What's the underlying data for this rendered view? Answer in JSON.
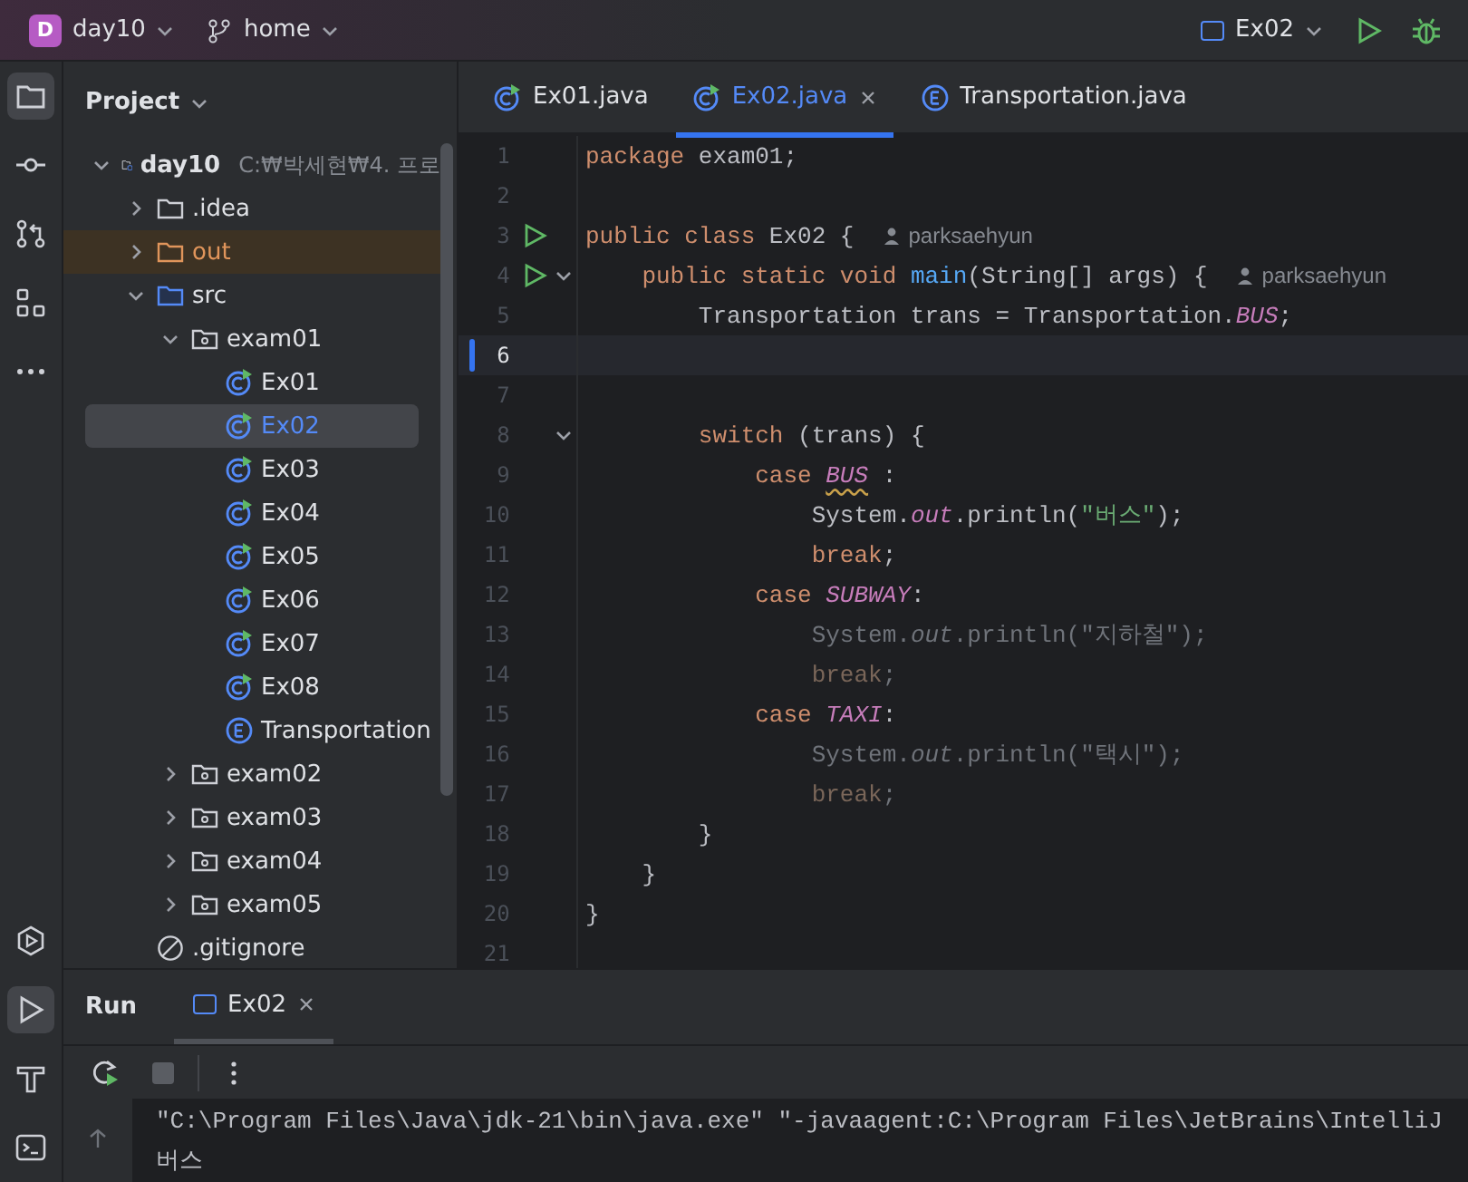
{
  "title_bar": {
    "project_badge": "D",
    "project": "day10",
    "branch": "home",
    "run_config": "Ex02"
  },
  "tool_strip": {
    "top": [
      {
        "kind": "project",
        "selected": true
      },
      {
        "kind": "commit",
        "selected": false
      },
      {
        "kind": "pull-requests",
        "selected": false
      },
      {
        "kind": "structure",
        "selected": false
      },
      {
        "kind": "more",
        "selected": false
      }
    ],
    "bottom": [
      {
        "kind": "services",
        "selected": false
      },
      {
        "kind": "run",
        "selected": true
      },
      {
        "kind": "build",
        "selected": false
      },
      {
        "kind": "terminal",
        "selected": false
      }
    ]
  },
  "project_panel": {
    "title": "Project",
    "tree": [
      {
        "name": "day10",
        "path": "C:₩박세현₩4. 프로",
        "kind": "project",
        "selected": false,
        "expanded": true,
        "children": [
          {
            "name": ".idea",
            "kind": "folder",
            "selected": false,
            "expanded": false
          },
          {
            "name": "out",
            "kind": "excluded",
            "selected": false,
            "expanded": false
          },
          {
            "name": "src",
            "kind": "source",
            "selected": false,
            "expanded": true,
            "children": [
              {
                "name": "exam01",
                "kind": "package",
                "selected": false,
                "expanded": true,
                "children": [
                  {
                    "name": "Ex01",
                    "kind": "class",
                    "selected": false
                  },
                  {
                    "name": "Ex02",
                    "kind": "class",
                    "selected": true
                  },
                  {
                    "name": "Ex03",
                    "kind": "class",
                    "selected": false
                  },
                  {
                    "name": "Ex04",
                    "kind": "class",
                    "selected": false
                  },
                  {
                    "name": "Ex05",
                    "kind": "class",
                    "selected": false
                  },
                  {
                    "name": "Ex06",
                    "kind": "class",
                    "selected": false
                  },
                  {
                    "name": "Ex07",
                    "kind": "class",
                    "selected": false
                  },
                  {
                    "name": "Ex08",
                    "kind": "class",
                    "selected": false
                  },
                  {
                    "name": "Transportation",
                    "kind": "enum",
                    "selected": false
                  }
                ]
              },
              {
                "name": "exam02",
                "kind": "package",
                "selected": false,
                "expanded": false
              },
              {
                "name": "exam03",
                "kind": "package",
                "selected": false,
                "expanded": false
              },
              {
                "name": "exam04",
                "kind": "package",
                "selected": false,
                "expanded": false
              },
              {
                "name": "exam05",
                "kind": "package",
                "selected": false,
                "expanded": false
              }
            ]
          },
          {
            "name": ".gitignore",
            "kind": "ignore",
            "selected": false
          }
        ]
      }
    ]
  },
  "editor": {
    "tabs": [
      {
        "label": "Ex01.java",
        "kind": "class",
        "selected": false
      },
      {
        "label": "Ex02.java",
        "kind": "class",
        "selected": true
      },
      {
        "label": "Transportation.java",
        "kind": "enum",
        "selected": false
      }
    ],
    "lines": [
      {
        "number": "1",
        "current": false,
        "run": false,
        "fold": false,
        "dimmed": false,
        "tokens": [
          {
            "text": "package ",
            "kind": "kw"
          },
          {
            "text": "exam01;",
            "kind": "plain"
          }
        ]
      },
      {
        "number": "2",
        "current": false,
        "run": false,
        "fold": false
      },
      {
        "number": "3",
        "current": false,
        "run": true,
        "fold": false,
        "dimmed": false,
        "author": "parksaehyun",
        "tokens": [
          {
            "text": "public class ",
            "kind": "kw"
          },
          {
            "text": "Ex02 {",
            "kind": "plain"
          }
        ]
      },
      {
        "number": "4",
        "current": false,
        "run": true,
        "fold": true,
        "dimmed": false,
        "author": "parksaehyun",
        "tokens": [
          {
            "text": "    public static void ",
            "kind": "kw"
          },
          {
            "text": "main",
            "kind": "fn"
          },
          {
            "text": "(String[] args) {",
            "kind": "plain"
          }
        ]
      },
      {
        "number": "5",
        "current": false,
        "run": false,
        "fold": false,
        "dimmed": false,
        "tokens": [
          {
            "text": "        Transportation trans = Transportation.",
            "kind": "plain"
          },
          {
            "text": "BUS",
            "kind": "field"
          },
          {
            "text": ";",
            "kind": "plain"
          }
        ]
      },
      {
        "number": "6",
        "current": true,
        "run": false,
        "fold": false
      },
      {
        "number": "7",
        "current": false,
        "run": false,
        "fold": false
      },
      {
        "number": "8",
        "current": false,
        "run": false,
        "fold": true,
        "dimmed": false,
        "tokens": [
          {
            "text": "        switch ",
            "kind": "kw"
          },
          {
            "text": "(trans) {",
            "kind": "plain"
          }
        ]
      },
      {
        "number": "9",
        "current": false,
        "run": false,
        "fold": false,
        "dimmed": false,
        "tokens": [
          {
            "text": "            case ",
            "kind": "kw"
          },
          {
            "text": "BUS",
            "kind": "field",
            "warning": true
          },
          {
            "text": " :",
            "kind": "plain"
          }
        ]
      },
      {
        "number": "10",
        "current": false,
        "run": false,
        "fold": false,
        "dimmed": false,
        "tokens": [
          {
            "text": "                System.",
            "kind": "plain"
          },
          {
            "text": "out",
            "kind": "field"
          },
          {
            "text": ".println(",
            "kind": "plain"
          },
          {
            "text": "\"버스\"",
            "kind": "string"
          },
          {
            "text": ");",
            "kind": "plain"
          }
        ]
      },
      {
        "number": "11",
        "current": false,
        "run": false,
        "fold": false,
        "dimmed": false,
        "tokens": [
          {
            "text": "                break",
            "kind": "kw"
          },
          {
            "text": ";",
            "kind": "plain"
          }
        ]
      },
      {
        "number": "12",
        "current": false,
        "run": false,
        "fold": false,
        "dimmed": false,
        "tokens": [
          {
            "text": "            case ",
            "kind": "kw"
          },
          {
            "text": "SUBWAY",
            "kind": "field"
          },
          {
            "text": ":",
            "kind": "plain"
          }
        ]
      },
      {
        "number": "13",
        "current": false,
        "run": false,
        "fold": false,
        "dimmed": true,
        "tokens": [
          {
            "text": "                System.",
            "kind": "plain"
          },
          {
            "text": "out",
            "kind": "field"
          },
          {
            "text": ".println(",
            "kind": "plain"
          },
          {
            "text": "\"지하철\"",
            "kind": "string"
          },
          {
            "text": ");",
            "kind": "plain"
          }
        ]
      },
      {
        "number": "14",
        "current": false,
        "run": false,
        "fold": false,
        "dimmed": true,
        "tokens": [
          {
            "text": "                break",
            "kind": "kw"
          },
          {
            "text": ";",
            "kind": "plain"
          }
        ]
      },
      {
        "number": "15",
        "current": false,
        "run": false,
        "fold": false,
        "dimmed": false,
        "tokens": [
          {
            "text": "            case ",
            "kind": "kw"
          },
          {
            "text": "TAXI",
            "kind": "field"
          },
          {
            "text": ":",
            "kind": "plain"
          }
        ]
      },
      {
        "number": "16",
        "current": false,
        "run": false,
        "fold": false,
        "dimmed": true,
        "tokens": [
          {
            "text": "                System.",
            "kind": "plain"
          },
          {
            "text": "out",
            "kind": "field"
          },
          {
            "text": ".println(",
            "kind": "plain"
          },
          {
            "text": "\"택시\"",
            "kind": "string"
          },
          {
            "text": ");",
            "kind": "plain"
          }
        ]
      },
      {
        "number": "17",
        "current": false,
        "run": false,
        "fold": false,
        "dimmed": true,
        "tokens": [
          {
            "text": "                break",
            "kind": "kw"
          },
          {
            "text": ";",
            "kind": "plain"
          }
        ]
      },
      {
        "number": "18",
        "current": false,
        "run": false,
        "fold": false,
        "dimmed": false,
        "tokens": [
          {
            "text": "        }",
            "kind": "plain"
          }
        ]
      },
      {
        "number": "19",
        "current": false,
        "run": false,
        "fold": false,
        "dimmed": false,
        "tokens": [
          {
            "text": "    }",
            "kind": "plain"
          }
        ]
      },
      {
        "number": "20",
        "current": false,
        "run": false,
        "fold": false,
        "dimmed": false,
        "tokens": [
          {
            "text": "}",
            "kind": "plain"
          }
        ]
      },
      {
        "number": "21",
        "current": false,
        "run": false,
        "fold": false
      }
    ]
  },
  "run_panel": {
    "title": "Run",
    "tabs": [
      {
        "label": "Ex02",
        "selected": true
      }
    ],
    "console": [
      "\"C:\\Program Files\\Java\\jdk-21\\bin\\java.exe\" \"-javaagent:C:\\Program Files\\JetBrains\\IntelliJ",
      "버스"
    ]
  }
}
